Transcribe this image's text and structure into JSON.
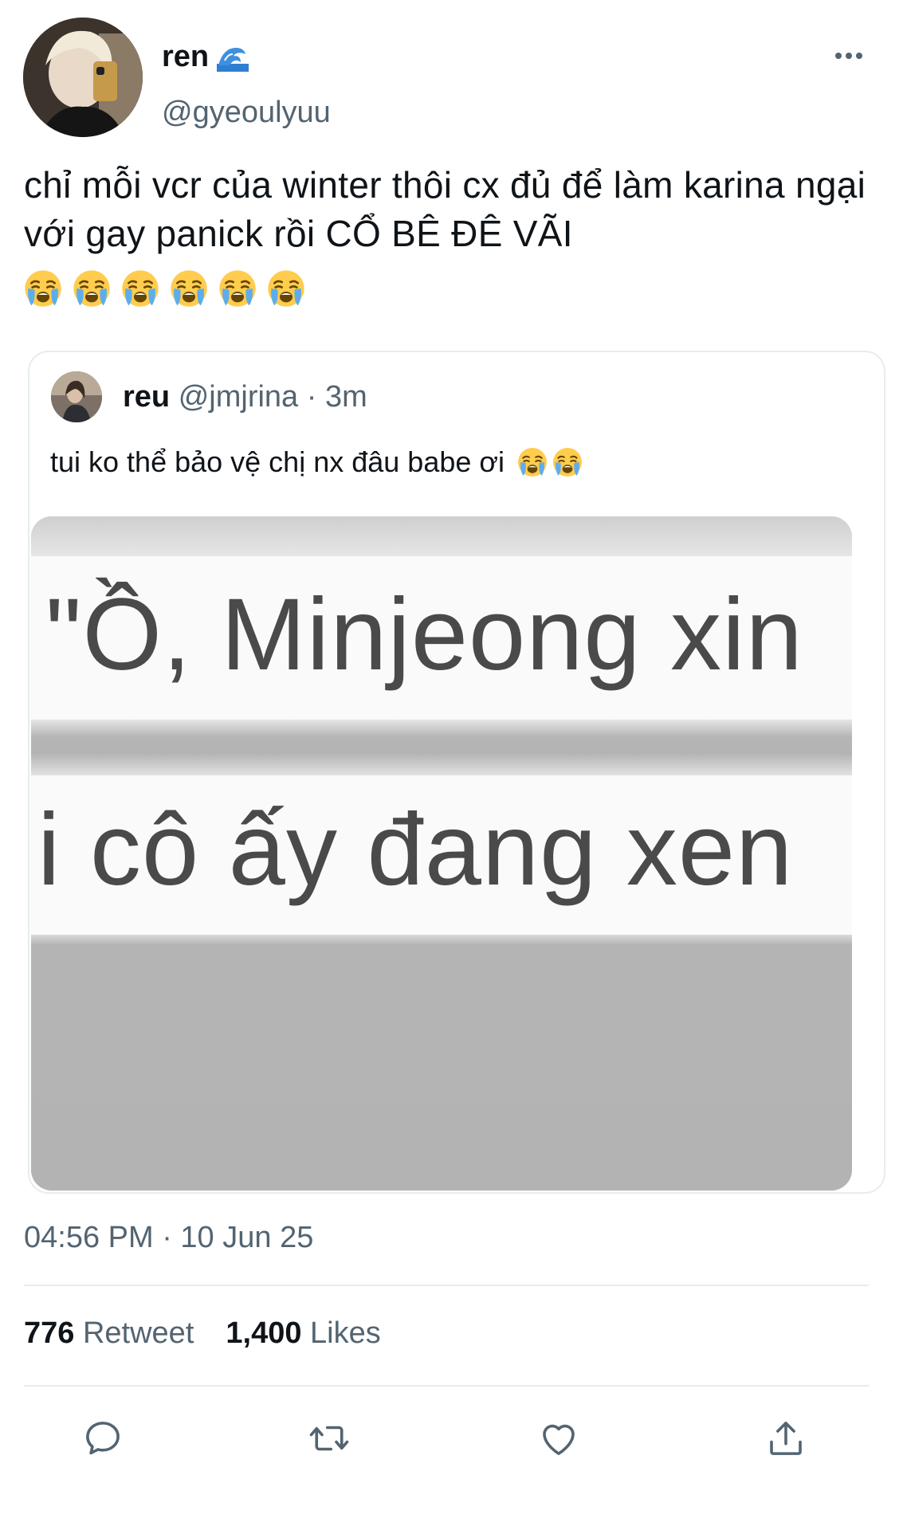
{
  "author": {
    "display_name": "ren",
    "name_emoji": "wave-icon",
    "handle": "@gyeoulyuu"
  },
  "tweet": {
    "text": "chỉ mỗi vcr của winter thôi cx đủ để làm karina ngại với gay panick rồi CỔ BÊ ĐÊ VÃI",
    "emoji_count": 6,
    "emoji_name": "loudly-crying-face"
  },
  "quote": {
    "display_name": "reu",
    "handle": "@jmjrina",
    "separator": "·",
    "time": "3m",
    "text": "tui ko thể bảo vệ chị nx đâu babe ơi",
    "emoji_count": 2,
    "media_lines": [
      "\"Ồ, Minjeong xin",
      "i cô ấy đang xen"
    ]
  },
  "meta": {
    "timestamp": "04:56 PM · 10 Jun 25"
  },
  "stats": {
    "retweets_count": "776",
    "retweets_label": "Retweet",
    "likes_count": "1,400",
    "likes_label": "Likes"
  },
  "actions": [
    "reply-icon",
    "retweet-icon",
    "like-icon",
    "share-icon"
  ],
  "colors": {
    "text": "#0f1419",
    "secondary": "#536471",
    "border": "#e6ecf0"
  }
}
